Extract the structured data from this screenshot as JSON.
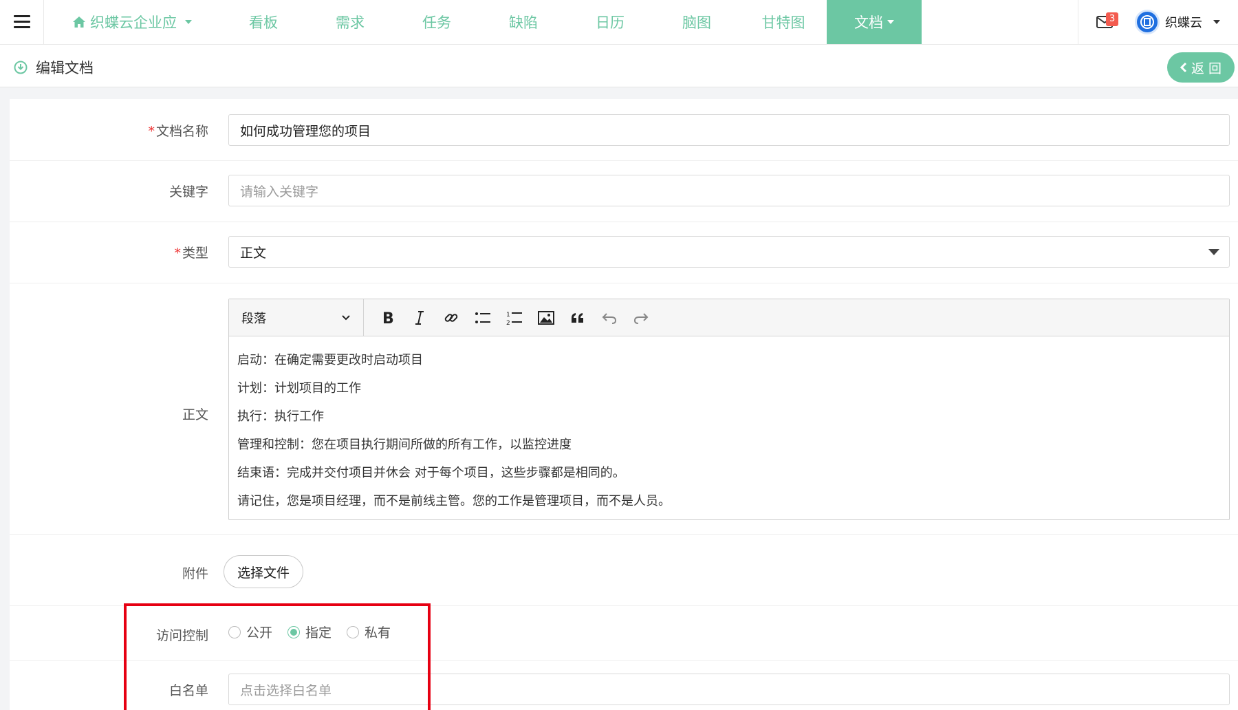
{
  "nav": {
    "brand": "织蝶云企业应",
    "items": [
      "看板",
      "需求",
      "任务",
      "缺陷",
      "日历",
      "脑图",
      "甘特图"
    ],
    "active": "文档"
  },
  "notifications": {
    "count": "3"
  },
  "user": {
    "name": "织蝶云",
    "avatar_text": "织蝶云"
  },
  "subheader": {
    "title": "编辑文档",
    "back_label": "返 回"
  },
  "form": {
    "name": {
      "label": "文档名称",
      "value": "如何成功管理您的项目"
    },
    "keywords": {
      "label": "关键字",
      "placeholder": "请输入关键字"
    },
    "type": {
      "label": "类型",
      "value": "正文"
    },
    "body": {
      "label": "正文",
      "paragraph_select": "段落",
      "lines": [
        "启动：在确定需要更改时启动项目",
        "计划：计划项目的工作",
        "执行：执行工作",
        "管理和控制：您在项目执行期间所做的所有工作，以监控进度",
        "结束语：完成并交付项目并休会  对于每个项目，这些步骤都是相同的。",
        "请记住，您是项目经理，而不是前线主管。您的工作是管理项目，而不是人员。"
      ]
    },
    "attachment": {
      "label": "附件",
      "button": "选择文件"
    },
    "access": {
      "label": "访问控制",
      "options": [
        "公开",
        "指定",
        "私有"
      ],
      "selected": "指定"
    },
    "whitelist": {
      "label": "白名单",
      "placeholder": "点击选择白名单"
    }
  },
  "colors": {
    "accent": "#6cc7a3",
    "highlight": "#e60012",
    "badge": "#f35b4f"
  }
}
